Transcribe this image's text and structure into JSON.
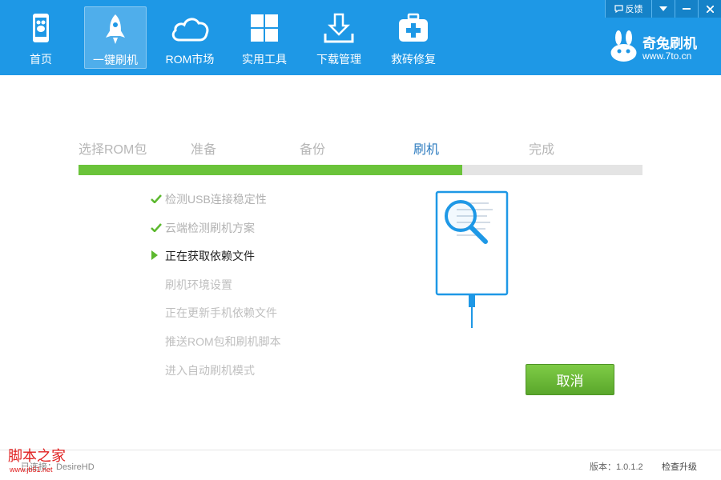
{
  "nav": {
    "items": [
      {
        "label": "首页",
        "icon": "phone-home-icon",
        "active": false
      },
      {
        "label": "一键刷机",
        "icon": "rocket-icon",
        "active": true
      },
      {
        "label": "ROM市场",
        "icon": "cloud-icon",
        "active": false
      },
      {
        "label": "实用工具",
        "icon": "grid-icon",
        "active": false
      },
      {
        "label": "下载管理",
        "icon": "download-icon",
        "active": false
      },
      {
        "label": "救砖修复",
        "icon": "first-aid-icon",
        "active": false
      }
    ]
  },
  "window_controls": {
    "feedback_label": "反馈",
    "menu_icon": "chevron-down-icon",
    "minimize_icon": "minimize-icon",
    "close_icon": "close-icon"
  },
  "brand": {
    "name": "奇兔刷机",
    "url": "www.7to.cn"
  },
  "steps": [
    {
      "label": "选择ROM包",
      "state": "done"
    },
    {
      "label": "准备",
      "state": "done"
    },
    {
      "label": "备份",
      "state": "done"
    },
    {
      "label": "刷机",
      "state": "current"
    },
    {
      "label": "完成",
      "state": "pending"
    }
  ],
  "progress": {
    "fraction": 0.68,
    "colors": {
      "fill": "#6bc33a",
      "track": "#e4e4e4"
    }
  },
  "tasks": [
    {
      "label": "检测USB连接稳定性",
      "status": "done"
    },
    {
      "label": "云端检测刷机方案",
      "status": "done"
    },
    {
      "label": "正在获取依赖文件",
      "status": "active"
    },
    {
      "label": "刷机环境设置",
      "status": "pending"
    },
    {
      "label": "正在更新手机依赖文件",
      "status": "pending"
    },
    {
      "label": "推送ROM包和刷机脚本",
      "status": "pending"
    },
    {
      "label": "进入自动刷机模式",
      "status": "pending"
    }
  ],
  "cancel_label": "取消",
  "footer": {
    "device": "已连接：DesireHD",
    "version": "版本：1.0.1.2",
    "check_update": "检查升级",
    "watermark": "脚本之家",
    "watermark_url": "www.jb51.net"
  },
  "colors": {
    "accent": "#1e98e6",
    "success": "#6bc33a",
    "current_step": "#2c7bbf",
    "illustration": "#1e98e6"
  }
}
